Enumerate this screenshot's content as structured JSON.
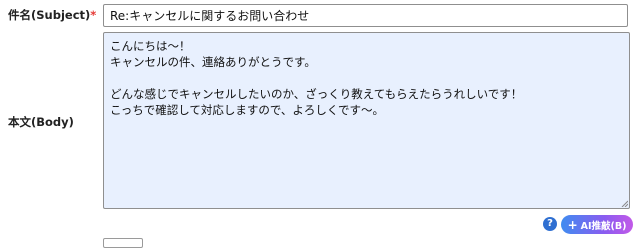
{
  "form": {
    "subject_label": "件名(Subject)",
    "required_mark": "*",
    "subject_value": "Re:キャンセルに関するお問い合わせ",
    "body_label": "本文(Body)",
    "body_value": "こんにちは〜！\nキャンセルの件、連絡ありがとうです。\n\nどんな感じでキャンセルしたいのか、ざっくり教えてもらえたらうれしいです！\nこっちで確認して対応しますので、よろしくです〜。"
  },
  "actions": {
    "help_glyph": "?",
    "ai_button_icon": "+",
    "ai_button_label": "AI推敲(B)"
  }
}
